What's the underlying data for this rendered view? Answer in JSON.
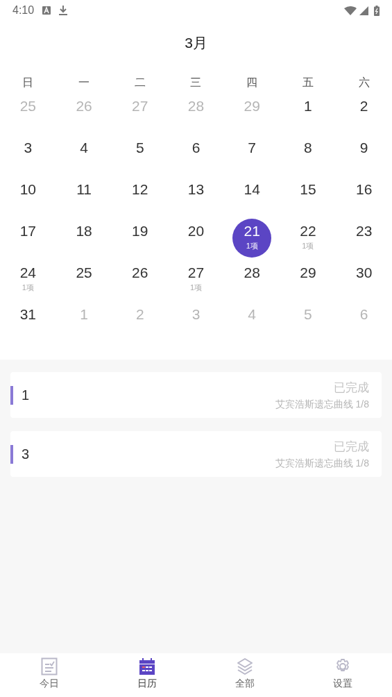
{
  "status_bar": {
    "time": "4:10"
  },
  "header": {
    "title": "3月"
  },
  "calendar": {
    "weekdays": [
      "日",
      "一",
      "二",
      "三",
      "四",
      "五",
      "六"
    ],
    "weeks": [
      [
        {
          "day": "25",
          "in_month": false,
          "selected": false
        },
        {
          "day": "26",
          "in_month": false,
          "selected": false
        },
        {
          "day": "27",
          "in_month": false,
          "selected": false
        },
        {
          "day": "28",
          "in_month": false,
          "selected": false
        },
        {
          "day": "29",
          "in_month": false,
          "selected": false
        },
        {
          "day": "1",
          "in_month": true,
          "selected": false
        },
        {
          "day": "2",
          "in_month": true,
          "selected": false
        }
      ],
      [
        {
          "day": "3",
          "in_month": true,
          "selected": false
        },
        {
          "day": "4",
          "in_month": true,
          "selected": false
        },
        {
          "day": "5",
          "in_month": true,
          "selected": false
        },
        {
          "day": "6",
          "in_month": true,
          "selected": false
        },
        {
          "day": "7",
          "in_month": true,
          "selected": false
        },
        {
          "day": "8",
          "in_month": true,
          "selected": false
        },
        {
          "day": "9",
          "in_month": true,
          "selected": false
        }
      ],
      [
        {
          "day": "10",
          "in_month": true,
          "selected": false
        },
        {
          "day": "11",
          "in_month": true,
          "selected": false
        },
        {
          "day": "12",
          "in_month": true,
          "selected": false
        },
        {
          "day": "13",
          "in_month": true,
          "selected": false
        },
        {
          "day": "14",
          "in_month": true,
          "selected": false
        },
        {
          "day": "15",
          "in_month": true,
          "selected": false
        },
        {
          "day": "16",
          "in_month": true,
          "selected": false
        }
      ],
      [
        {
          "day": "17",
          "in_month": true,
          "selected": false
        },
        {
          "day": "18",
          "in_month": true,
          "selected": false
        },
        {
          "day": "19",
          "in_month": true,
          "selected": false
        },
        {
          "day": "20",
          "in_month": true,
          "selected": false
        },
        {
          "day": "21",
          "in_month": true,
          "selected": true,
          "count": "1项"
        },
        {
          "day": "22",
          "in_month": true,
          "selected": false,
          "count": "1项"
        },
        {
          "day": "23",
          "in_month": true,
          "selected": false
        }
      ],
      [
        {
          "day": "24",
          "in_month": true,
          "selected": false,
          "count": "1项"
        },
        {
          "day": "25",
          "in_month": true,
          "selected": false
        },
        {
          "day": "26",
          "in_month": true,
          "selected": false
        },
        {
          "day": "27",
          "in_month": true,
          "selected": false,
          "count": "1项"
        },
        {
          "day": "28",
          "in_month": true,
          "selected": false
        },
        {
          "day": "29",
          "in_month": true,
          "selected": false
        },
        {
          "day": "30",
          "in_month": true,
          "selected": false
        }
      ],
      [
        {
          "day": "31",
          "in_month": true,
          "selected": false
        },
        {
          "day": "1",
          "in_month": false,
          "selected": false
        },
        {
          "day": "2",
          "in_month": false,
          "selected": false
        },
        {
          "day": "3",
          "in_month": false,
          "selected": false
        },
        {
          "day": "4",
          "in_month": false,
          "selected": false
        },
        {
          "day": "5",
          "in_month": false,
          "selected": false
        },
        {
          "day": "6",
          "in_month": false,
          "selected": false
        }
      ]
    ]
  },
  "tasks": [
    {
      "title": "1",
      "status": "已完成",
      "schedule": "艾宾浩斯遗忘曲线 1/8"
    },
    {
      "title": "3",
      "status": "已完成",
      "schedule": "艾宾浩斯遗忘曲线 1/8"
    }
  ],
  "bottom_nav": [
    {
      "kind": "today",
      "label": "今日",
      "selected": false
    },
    {
      "kind": "calendar",
      "label": "日历",
      "selected": true
    },
    {
      "kind": "all",
      "label": "全部",
      "selected": false
    },
    {
      "kind": "settings",
      "label": "设置",
      "selected": false
    }
  ]
}
